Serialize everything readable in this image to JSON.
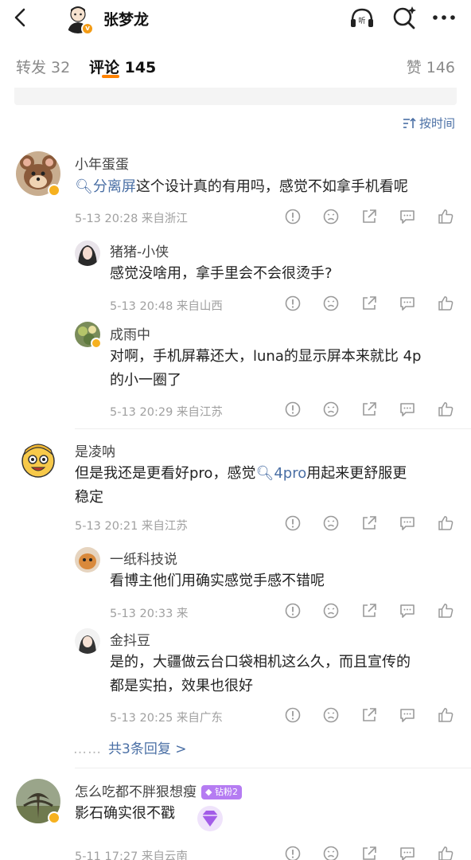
{
  "header": {
    "name": "张梦龙"
  },
  "tabs": {
    "repost": "转发 32",
    "comments": "评论 145",
    "likes": "赞 146"
  },
  "sort_label": "按时间",
  "comments": [
    {
      "user": "小年蛋蛋",
      "topic": "分离屏",
      "text": "这个设计真的有用吗，感觉不如拿手机看呢",
      "meta": "5-13 20:28 来自浙江",
      "replies": [
        {
          "user": "猪猪-小侠",
          "text": "感觉没啥用，拿手里会不会很烫手?",
          "meta": "5-13 20:48 来自山西"
        },
        {
          "user": "成雨中",
          "text_line1": "对啊，手机屏幕还大，luna的显示屏本来就比 4p",
          "text_line2": "的小一圈了",
          "meta": "5-13 20:29 来自江苏"
        }
      ]
    },
    {
      "user": "是凌呐",
      "text_a": "但是我还是更看好pro，感觉",
      "topic": "4pro",
      "text_b": "用起来更舒服更",
      "text_c": "稳定",
      "meta": "5-13 20:21 来自江苏",
      "replies": [
        {
          "user": "一纸科技说",
          "text": "看博主他们用确实感觉手感不错呢",
          "meta": "5-13 20:33 来"
        },
        {
          "user": "金抖豆",
          "text_line1": "是的，大疆做云台口袋相机这么久，而且宣传的",
          "text_line2": "都是实拍，效果也很好",
          "meta": "5-13 20:25 来自广东"
        }
      ],
      "more_replies": "共3条回复 >"
    },
    {
      "user": "怎么吃都不胖狠想瘦",
      "fan_badge": "钻粉2",
      "text": "影石确实很不戳",
      "meta": "5-11 17:27 来自云南"
    }
  ],
  "colors": {
    "accent": "#ff8200",
    "link": "#4a6fa5",
    "meta": "#a0a0a0"
  },
  "icons": [
    "back-icon",
    "listen-icon",
    "search-icon",
    "more-icon",
    "sort-icon",
    "report-icon",
    "dislike-icon",
    "share-icon",
    "reply-icon",
    "like-icon"
  ]
}
